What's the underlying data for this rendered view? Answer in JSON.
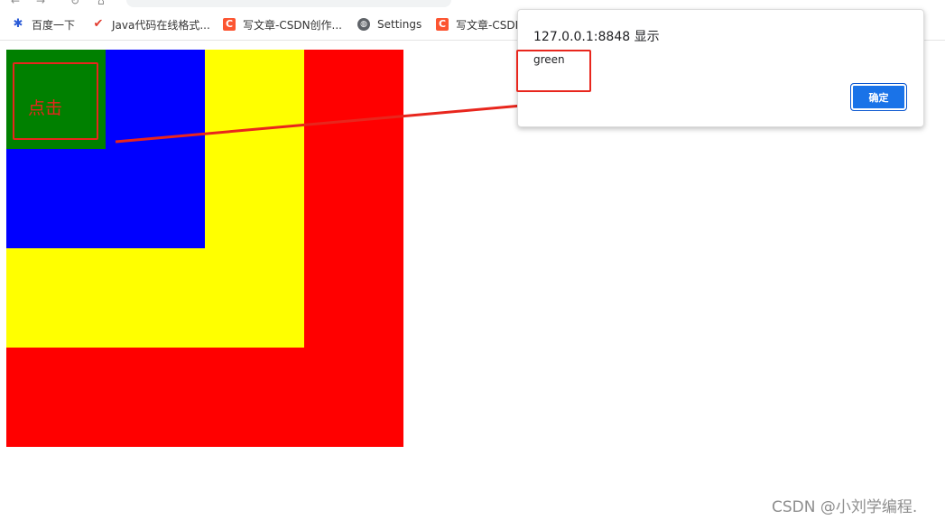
{
  "bookmarks": [
    {
      "label": "百度一下",
      "icon": "baidu-paw-icon"
    },
    {
      "label": "Java代码在线格式...",
      "icon": "red-check-icon"
    },
    {
      "label": "写文章-CSDN创作...",
      "icon": "csdn-icon"
    },
    {
      "label": "Settings",
      "icon": "globe-icon"
    },
    {
      "label": "写文章-CSDI",
      "icon": "csdn-icon"
    }
  ],
  "page": {
    "click_label": "点击",
    "colors": {
      "red": "#ff0000",
      "yellow": "#ffff00",
      "blue": "#0000ff",
      "green": "#008000",
      "annotation": "#e8261d"
    }
  },
  "alert": {
    "title": "127.0.0.1:8848 显示",
    "message": "green",
    "ok_label": "确定"
  },
  "watermark": "CSDN @小刘学编程."
}
